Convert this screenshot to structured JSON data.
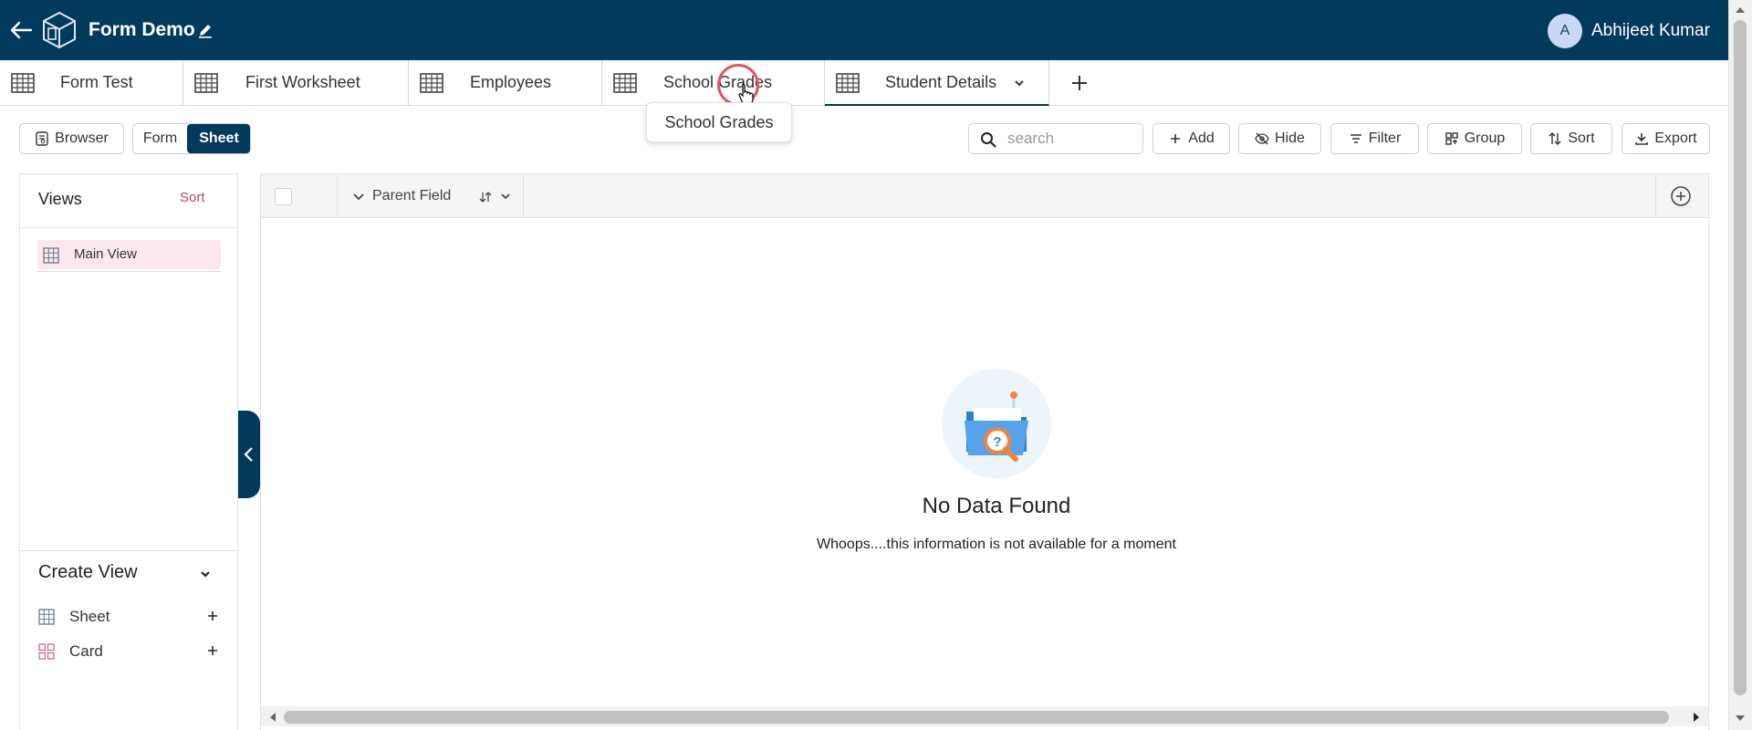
{
  "header": {
    "title": "Form Demo",
    "user_initial": "A",
    "user_name": "Abhijeet Kumar",
    "bg_color": "#023a5c"
  },
  "tabs": [
    {
      "label": "Form Test"
    },
    {
      "label": "First Worksheet"
    },
    {
      "label": "Employees"
    },
    {
      "label": "School Grades"
    },
    {
      "label": "Student Details",
      "active": true
    }
  ],
  "tooltip": {
    "text": "School Grades"
  },
  "toolbar": {
    "browser_label": "Browser",
    "form_label": "Form",
    "sheet_label": "Sheet",
    "search_placeholder": "search",
    "add_label": "Add",
    "hide_label": "Hide",
    "filter_label": "Filter",
    "group_label": "Group",
    "sort_label": "Sort",
    "export_label": "Export"
  },
  "views": {
    "title": "Views",
    "sort_label": "Sort",
    "items": [
      {
        "label": "Main View"
      }
    ]
  },
  "create_view": {
    "title": "Create View",
    "items": [
      {
        "label": "Sheet"
      },
      {
        "label": "Card"
      }
    ]
  },
  "grid": {
    "column_header": "Parent Field",
    "empty_title": "No Data Found",
    "empty_message": "Whoops....this information is not available for a moment"
  },
  "colors": {
    "primary": "#023a5c",
    "accent": "#b54a5a",
    "active_view_bg": "#fbe8ee"
  }
}
